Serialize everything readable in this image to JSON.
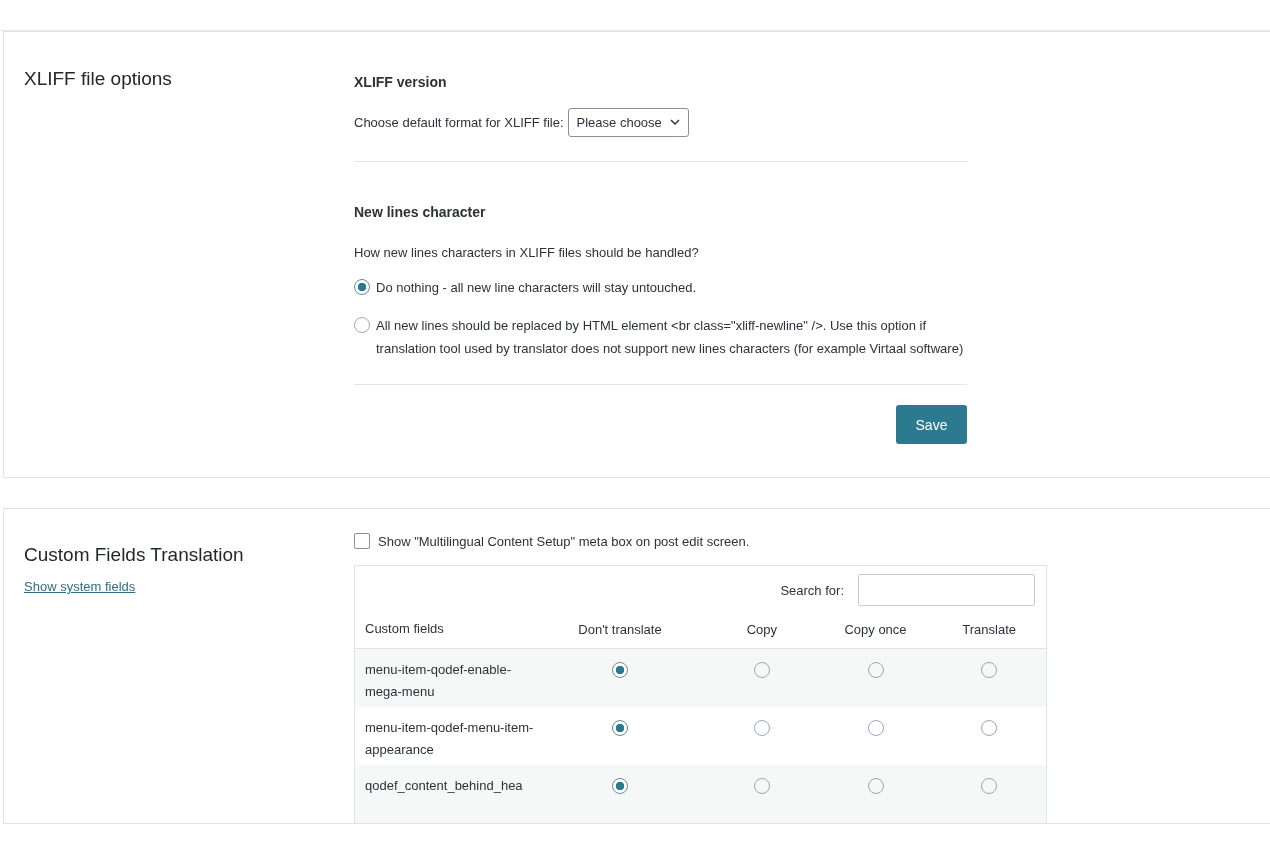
{
  "xliff_options": {
    "title": "XLIFF file options",
    "version": {
      "heading": "XLIFF version",
      "label": "Choose default format for XLIFF file:",
      "select_value": "Please choose"
    },
    "new_lines": {
      "heading": "New lines character",
      "question": "How new lines characters in XLIFF files should be handled?",
      "options": [
        {
          "label": "Do nothing - all new line characters will stay untouched.",
          "selected": true
        },
        {
          "label": "All new lines should be replaced by HTML element <br class=\"xliff-newline\" />. Use this option if translation tool used by translator does not support new lines characters (for example Virtaal software)",
          "selected": false
        }
      ]
    },
    "save_button": "Save"
  },
  "custom_fields": {
    "title": "Custom Fields Translation",
    "link": "Show system fields",
    "meta_box": {
      "label": "Show \"Multilingual Content Setup\" meta box on post edit screen.",
      "checked": false
    },
    "search_label": "Search for:",
    "columns": [
      "Custom fields",
      "Don't translate",
      "Copy",
      "Copy once",
      "Translate"
    ],
    "rows": [
      {
        "field": "menu-item-qodef-enable-mega-menu",
        "options": [
          {
            "selected": true
          },
          {
            "selected": false
          },
          {
            "selected": false
          },
          {
            "selected": false
          }
        ]
      },
      {
        "field": "menu-item-qodef-menu-item-appearance",
        "options": [
          {
            "selected": true
          },
          {
            "selected": false
          },
          {
            "selected": false
          },
          {
            "selected": false
          }
        ]
      },
      {
        "field": "qodef_content_behind_hea",
        "options": [
          {
            "selected": true
          },
          {
            "selected": false
          },
          {
            "selected": false
          },
          {
            "selected": false
          }
        ]
      }
    ]
  }
}
